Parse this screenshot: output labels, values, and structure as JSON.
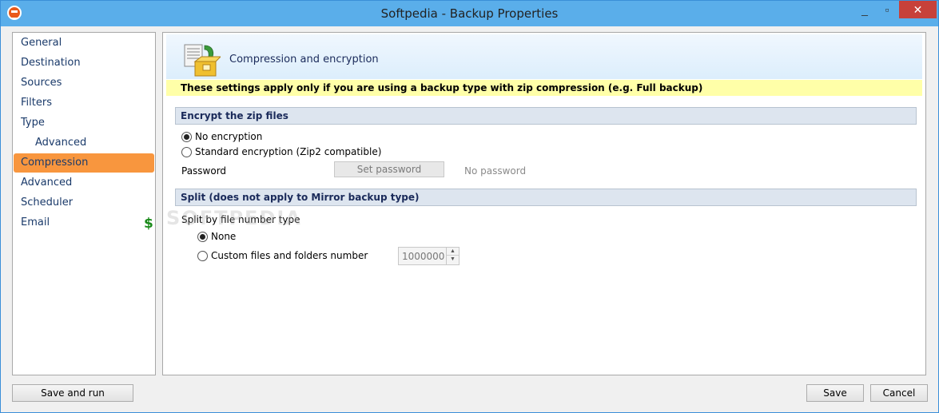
{
  "window": {
    "title": "Softpedia - Backup Properties",
    "minimize": "_",
    "maximize": "▫",
    "close": "✕"
  },
  "sidebar": {
    "items": [
      {
        "label": "General"
      },
      {
        "label": "Destination"
      },
      {
        "label": "Sources"
      },
      {
        "label": "Filters"
      },
      {
        "label": "Type"
      },
      {
        "label": "Advanced"
      },
      {
        "label": "Compression"
      },
      {
        "label": "Advanced"
      },
      {
        "label": "Scheduler"
      },
      {
        "label": "Email"
      }
    ],
    "email_badge": "$",
    "active_index": 6
  },
  "header": {
    "title": "Compression and encryption",
    "icon": "package-compress-icon"
  },
  "note": "These settings apply only if you are using a backup type with zip compression (e.g. Full backup)",
  "encrypt": {
    "section_title": "Encrypt the zip files",
    "options": [
      "No encryption",
      "Standard encryption (Zip2 compatible)"
    ],
    "selected": 0,
    "password_label": "Password",
    "set_password_button": "Set password",
    "password_status": "No password"
  },
  "split": {
    "section_title": "Split (does not apply to Mirror backup type)",
    "subtitle": "Split by file number type",
    "options": [
      "None",
      "Custom files and folders number"
    ],
    "selected": 0,
    "number_value": "1000000"
  },
  "watermark": "SOFTPEDIA",
  "footer": {
    "save_and_run": "Save and run",
    "save": "Save",
    "cancel": "Cancel"
  },
  "colors": {
    "titlebar": "#5aaeea",
    "active_nav": "#f8963e",
    "note_bg": "#ffffa8",
    "close_button": "#c7413a"
  }
}
